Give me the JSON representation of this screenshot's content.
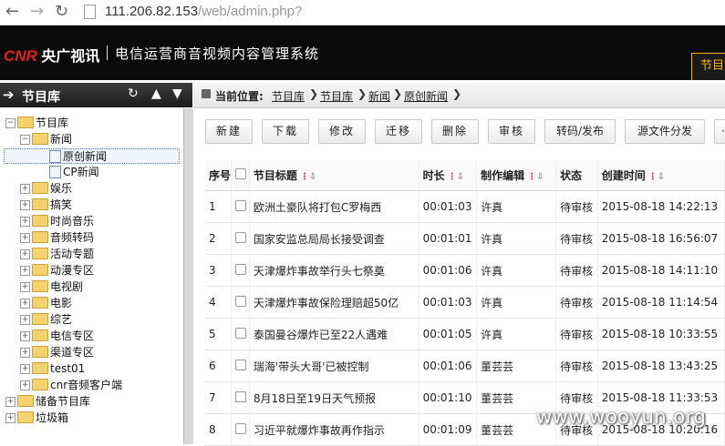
{
  "browser": {
    "url_host": "111.206.82.153",
    "url_path": "/web/admin.php?"
  },
  "header": {
    "logo_cnr": "CNR",
    "logo_text": "央广视讯",
    "title": "电信运营商音视频内容管理系统",
    "tab_label": "节目"
  },
  "sidebar": {
    "title": "节目库",
    "tree": [
      {
        "label": "节目库",
        "level": 0,
        "toggle": "−",
        "icon": "folder"
      },
      {
        "label": "新闻",
        "level": 1,
        "toggle": "−",
        "icon": "folder"
      },
      {
        "label": "原创新闻",
        "level": 2,
        "toggle": "",
        "icon": "file",
        "selected": true
      },
      {
        "label": "CP新闻",
        "level": 2,
        "toggle": "",
        "icon": "file"
      },
      {
        "label": "娱乐",
        "level": 1,
        "toggle": "+",
        "icon": "folder"
      },
      {
        "label": "搞笑",
        "level": 1,
        "toggle": "+",
        "icon": "folder"
      },
      {
        "label": "时尚音乐",
        "level": 1,
        "toggle": "+",
        "icon": "folder"
      },
      {
        "label": "音频转码",
        "level": 1,
        "toggle": "+",
        "icon": "folder"
      },
      {
        "label": "活动专题",
        "level": 1,
        "toggle": "+",
        "icon": "folder"
      },
      {
        "label": "动漫专区",
        "level": 1,
        "toggle": "+",
        "icon": "folder"
      },
      {
        "label": "电视剧",
        "level": 1,
        "toggle": "+",
        "icon": "folder"
      },
      {
        "label": "电影",
        "level": 1,
        "toggle": "+",
        "icon": "folder"
      },
      {
        "label": "综艺",
        "level": 1,
        "toggle": "+",
        "icon": "folder"
      },
      {
        "label": "电信专区",
        "level": 1,
        "toggle": "+",
        "icon": "folder"
      },
      {
        "label": "渠道专区",
        "level": 1,
        "toggle": "+",
        "icon": "folder"
      },
      {
        "label": "test01",
        "level": 1,
        "toggle": "+",
        "icon": "folder"
      },
      {
        "label": "cnr音频客户端",
        "level": 1,
        "toggle": "+",
        "icon": "folder"
      },
      {
        "label": "储备节目库",
        "level": 0,
        "toggle": "+",
        "icon": "folder"
      },
      {
        "label": "垃圾箱",
        "level": 0,
        "toggle": "+",
        "icon": "folder"
      }
    ]
  },
  "breadcrumb": {
    "label": "当前位置:",
    "items": [
      "节目库",
      "节目库",
      "新闻",
      "原创新闻"
    ]
  },
  "toolbar": {
    "buttons": [
      "新建",
      "下载",
      "修改",
      "迁移",
      "删除",
      "审核",
      "转码/发布",
      "源文件分发",
      "·"
    ]
  },
  "table": {
    "headers": [
      "序号",
      "",
      "节目标题",
      "时长",
      "制作编辑",
      "状态",
      "创建时间"
    ],
    "rows": [
      [
        "1",
        "欧洲土豪队将打包C罗梅西",
        "00:01:03",
        "许真",
        "待审核",
        "2015-08-18 14:22:13"
      ],
      [
        "2",
        "国家安监总局局长接受调查",
        "00:01:01",
        "许真",
        "待审核",
        "2015-08-18 16:56:07"
      ],
      [
        "3",
        "天津爆炸事故举行头七祭奠",
        "00:01:06",
        "许真",
        "待审核",
        "2015-08-18 14:11:10"
      ],
      [
        "4",
        "天津爆炸事故保险理赔超50亿",
        "00:01:03",
        "许真",
        "待审核",
        "2015-08-18 11:14:54"
      ],
      [
        "5",
        "泰国曼谷爆炸已至22人遇难",
        "00:01:05",
        "许真",
        "待审核",
        "2015-08-18 10:33:55"
      ],
      [
        "6",
        "瑞海'带头大哥'已被控制",
        "00:01:06",
        "董芸芸",
        "待审核",
        "2015-08-18 13:43:25"
      ],
      [
        "7",
        "8月18日至19日天气预报",
        "00:01:10",
        "董芸芸",
        "待审核",
        "2015-08-18 11:33:53"
      ],
      [
        "8",
        "习近平就爆炸事故再作指示",
        "00:01:09",
        "董芸芸",
        "待审核",
        "2015-08-18 10:20:16"
      ]
    ]
  },
  "watermark": "www.wooyun.org"
}
